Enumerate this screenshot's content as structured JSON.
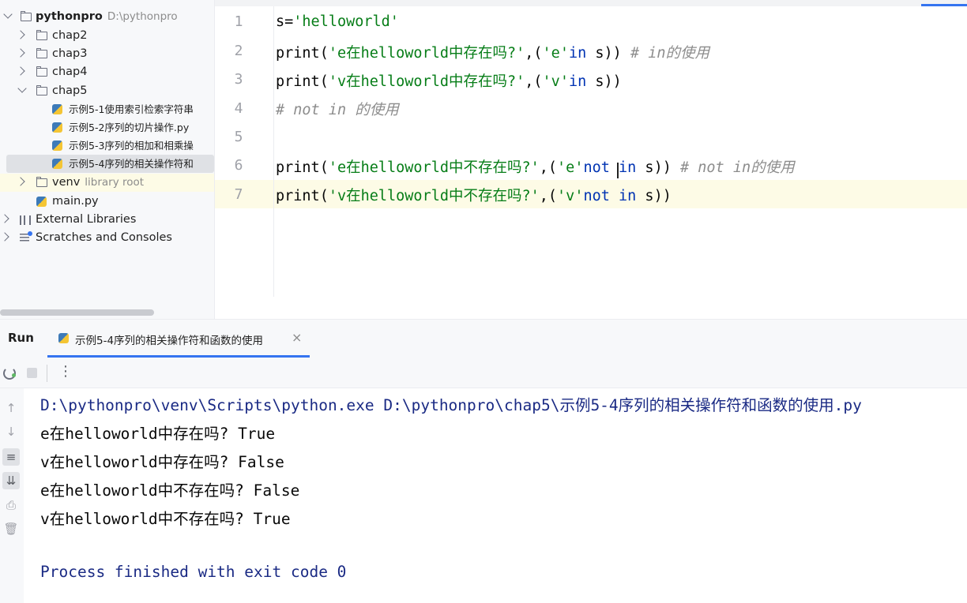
{
  "project_tree": {
    "root": {
      "name": "pythonpro",
      "path": "D:\\pythonpro"
    },
    "items": [
      {
        "label": "chap2"
      },
      {
        "label": "chap3"
      },
      {
        "label": "chap4"
      },
      {
        "label": "chap5"
      },
      {
        "label": "示例5-1使用索引检索字符串"
      },
      {
        "label": "示例5-2序列的切片操作.py"
      },
      {
        "label": "示例5-3序列的相加和相乘操"
      },
      {
        "label": "示例5-4序列的相关操作符和"
      },
      {
        "label": "venv",
        "hint": "library root"
      },
      {
        "label": "main.py"
      },
      {
        "label": "External Libraries"
      },
      {
        "label": "Scratches and Consoles"
      }
    ]
  },
  "editor": {
    "line_numbers": [
      "1",
      "2",
      "3",
      "4",
      "5",
      "6",
      "7"
    ],
    "lines": [
      {
        "parts": [
          "s=",
          "'helloworld'"
        ]
      },
      {
        "parts": [
          "print(",
          "'e在helloworld中存在吗?'",
          ",(",
          "'e'",
          "in",
          " s)) ",
          "# in的使用"
        ]
      },
      {
        "parts": [
          "print(",
          "'v在helloworld中存在吗?'",
          ",(",
          "'v'",
          "in",
          " s))"
        ]
      },
      {
        "parts": [
          "# not in 的使用"
        ]
      },
      {
        "parts": [
          ""
        ]
      },
      {
        "parts": [
          "print(",
          "'e在helloworld中不存在吗?'",
          ",(",
          "'e'",
          "not in",
          " s)) ",
          "# not in的使用"
        ]
      },
      {
        "parts": [
          "print(",
          "'v在helloworld中不存在吗?'",
          ",(",
          "'v'",
          "not in",
          " s))"
        ]
      }
    ]
  },
  "run": {
    "title": "Run",
    "tab_label": "示例5-4序列的相关操作符和函数的使用",
    "tab_close": "×",
    "toolbar_more": "⋮",
    "output": [
      "D:\\pythonpro\\venv\\Scripts\\python.exe D:\\pythonpro\\chap5\\示例5-4序列的相关操作符和函数的使用.py",
      "e在helloworld中存在吗? True",
      "v在helloworld中存在吗? False",
      "e在helloworld中不存在吗? False",
      "v在helloworld中不存在吗? True",
      "",
      "Process finished with exit code 0"
    ]
  },
  "colors": {
    "string": "#067d17",
    "keyword": "#0033b3",
    "comment": "#8c8c8c",
    "console_system": "#1a2a84",
    "accent": "#3574f0"
  }
}
